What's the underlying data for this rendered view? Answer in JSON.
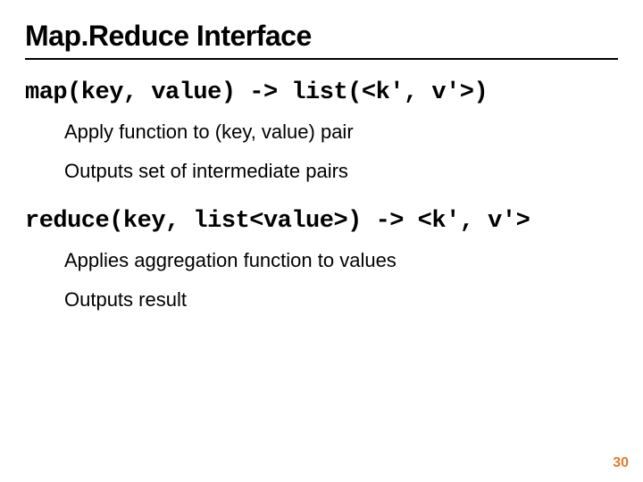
{
  "title": "Map.Reduce Interface",
  "map_signature": "map(key, value) -> list(<k', v'>)",
  "map_bullets": [
    "Apply function to (key, value) pair",
    "Outputs set of intermediate pairs"
  ],
  "reduce_signature": "reduce(key, list<value>) -> <k', v'>",
  "reduce_bullets": [
    "Applies aggregation function to values",
    "Outputs result"
  ],
  "page_number": "30"
}
